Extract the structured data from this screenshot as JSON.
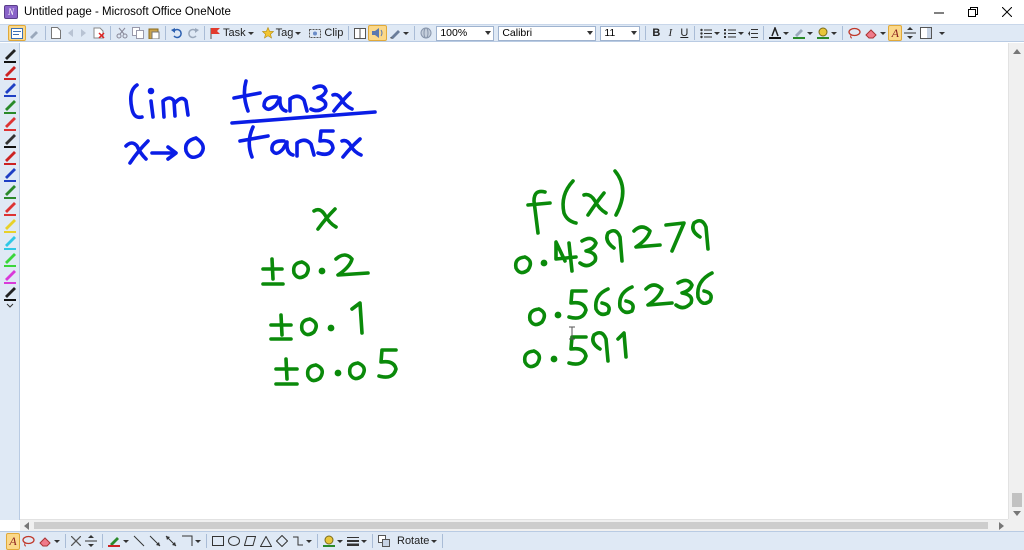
{
  "window": {
    "title": "Untitled page - Microsoft Office OneNote",
    "app_icon_letter": "N"
  },
  "toolbar": {
    "task_label": "Task",
    "tag_label": "Tag",
    "clip_label": "Clip",
    "zoom_value": "100%",
    "font_name": "Calibri",
    "font_size": "11",
    "bold_label": "B",
    "italic_label": "I",
    "underline_label": "U",
    "ink_to_text_label": "A"
  },
  "drawing_toolbar": {
    "rotate_label": "Rotate"
  },
  "colors": {
    "ink_blue": "#0a1de6",
    "ink_green": "#0a8a0a",
    "toolbar_bg": "#dfe9f5",
    "active_tool": "#fbd889"
  },
  "handwriting": {
    "limit_word": "lim",
    "limit_subscript": "x→0",
    "numerator": "tan3x",
    "denominator": "tan5x",
    "x_header": "x",
    "fx_header": "f(x)",
    "x_values": [
      "±0.2",
      "±0.1",
      "±0.05"
    ],
    "fx_values": [
      "0.439279",
      "0.566236",
      "0.591"
    ]
  },
  "icons": [
    "minimize-icon",
    "restore-icon",
    "close-icon",
    "pen-icon",
    "eraser-icon",
    "lasso-icon",
    "bold-icon",
    "italic-icon",
    "underline-icon",
    "bullets-icon",
    "numbering-icon",
    "font-color-icon",
    "highlight-icon",
    "rectangle-icon",
    "ellipse-icon",
    "diamond-icon",
    "line-icon"
  ]
}
